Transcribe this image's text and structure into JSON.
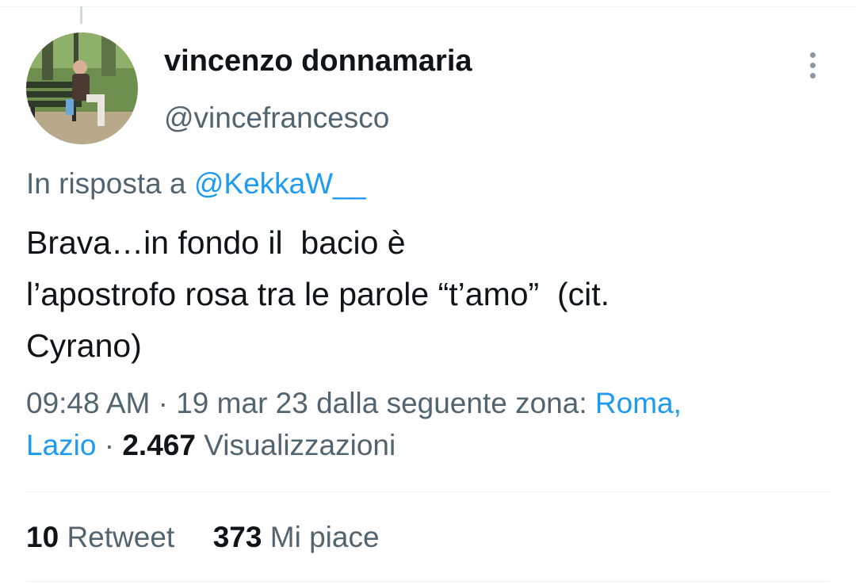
{
  "tweet": {
    "author": {
      "display_name": "vincenzo donnamaria",
      "handle": "@vincefrancesco"
    },
    "reply_to": {
      "prefix": "In risposta a",
      "mention": "@KekkaW__"
    },
    "text_lines": [
      "Brava…in fondo il  bacio è",
      "l’apostrofo rosa tra le parole “t’amo”  (cit.",
      "Cyrano)"
    ],
    "meta": {
      "time": "09:48 AM",
      "separator": "·",
      "date": "19 mar 23",
      "location_prefix": "dalla seguente zona:",
      "location_part1": "Roma,",
      "location_part2": "Lazio",
      "views_count": "2.467",
      "views_label": "Visualizzazioni"
    },
    "stats": {
      "retweets_count": "10",
      "retweets_label": "Retweet",
      "likes_count": "373",
      "likes_label": "Mi piace"
    }
  },
  "icons": {
    "more": "more-options-icon"
  },
  "colors": {
    "text_primary": "#0f1419",
    "text_secondary": "#536471",
    "link": "#1d9bf0",
    "divider": "#eff3f4"
  }
}
